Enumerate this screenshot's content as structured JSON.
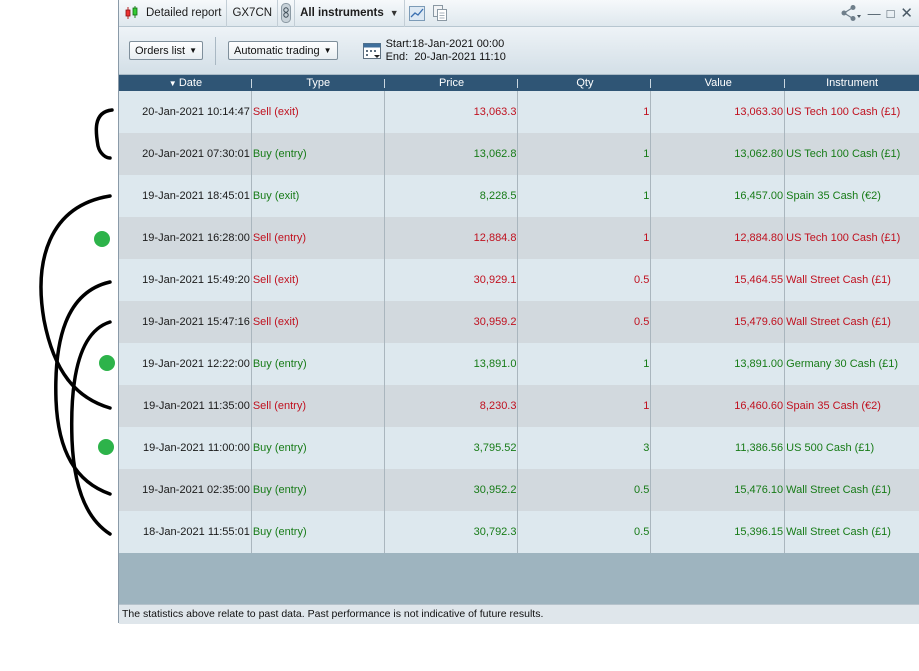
{
  "titlebar": {
    "report_label": "Detailed report",
    "account": "GX7CN",
    "instrument_filter": "All instruments",
    "controls": [
      "share-icon",
      "minimize-icon",
      "maximize-icon",
      "close-icon"
    ]
  },
  "toolbar": {
    "orders_dropdown": "Orders list",
    "trading_dropdown": "Automatic trading",
    "start": "Start:18-Jan-2021 00:00",
    "end": "End:  20-Jan-2021 11:10"
  },
  "table": {
    "columns": [
      "Date",
      "Type",
      "Price",
      "Qty",
      "Value",
      "Instrument"
    ],
    "sort_column": "Date",
    "rows": [
      {
        "date": "20-Jan-2021 10:14:47",
        "type": "Sell (exit)",
        "price": "13,063.3",
        "qty": "1",
        "value": "13,063.30",
        "instrument": "US Tech 100 Cash (£1)",
        "side": "sell"
      },
      {
        "date": "20-Jan-2021 07:30:01",
        "type": "Buy (entry)",
        "price": "13,062.8",
        "qty": "1",
        "value": "13,062.80",
        "instrument": "US Tech 100 Cash (£1)",
        "side": "buy"
      },
      {
        "date": "19-Jan-2021 18:45:01",
        "type": "Buy (exit)",
        "price": "8,228.5",
        "qty": "1",
        "value": "16,457.00",
        "instrument": "Spain 35 Cash (€2)",
        "side": "buy"
      },
      {
        "date": "19-Jan-2021 16:28:00",
        "type": "Sell (entry)",
        "price": "12,884.8",
        "qty": "1",
        "value": "12,884.80",
        "instrument": "US Tech 100 Cash (£1)",
        "side": "sell"
      },
      {
        "date": "19-Jan-2021 15:49:20",
        "type": "Sell (exit)",
        "price": "30,929.1",
        "qty": "0.5",
        "value": "15,464.55",
        "instrument": "Wall Street Cash (£1)",
        "side": "sell"
      },
      {
        "date": "19-Jan-2021 15:47:16",
        "type": "Sell (exit)",
        "price": "30,959.2",
        "qty": "0.5",
        "value": "15,479.60",
        "instrument": "Wall Street Cash (£1)",
        "side": "sell"
      },
      {
        "date": "19-Jan-2021 12:22:00",
        "type": "Buy (entry)",
        "price": "13,891.0",
        "qty": "1",
        "value": "13,891.00",
        "instrument": "Germany 30 Cash (£1)",
        "side": "buy"
      },
      {
        "date": "19-Jan-2021 11:35:00",
        "type": "Sell (entry)",
        "price": "8,230.3",
        "qty": "1",
        "value": "16,460.60",
        "instrument": "Spain 35 Cash (€2)",
        "side": "sell"
      },
      {
        "date": "19-Jan-2021 11:00:00",
        "type": "Buy (entry)",
        "price": "3,795.52",
        "qty": "3",
        "value": "11,386.56",
        "instrument": "US 500 Cash (£1)",
        "side": "buy"
      },
      {
        "date": "19-Jan-2021 02:35:00",
        "type": "Buy (entry)",
        "price": "30,952.2",
        "qty": "0.5",
        "value": "15,476.10",
        "instrument": "Wall Street Cash (£1)",
        "side": "buy"
      },
      {
        "date": "18-Jan-2021 11:55:01",
        "type": "Buy (entry)",
        "price": "30,792.3",
        "qty": "0.5",
        "value": "15,396.15",
        "instrument": "Wall Street Cash (£1)",
        "side": "buy"
      }
    ]
  },
  "footer": {
    "disclaimer": "The statistics above relate to past data. Past performance is not indicative of future results."
  },
  "colors": {
    "sell": "#c0111f",
    "buy": "#177b17",
    "header_bg": "#2f5575",
    "marker_green": "#2db34a"
  }
}
